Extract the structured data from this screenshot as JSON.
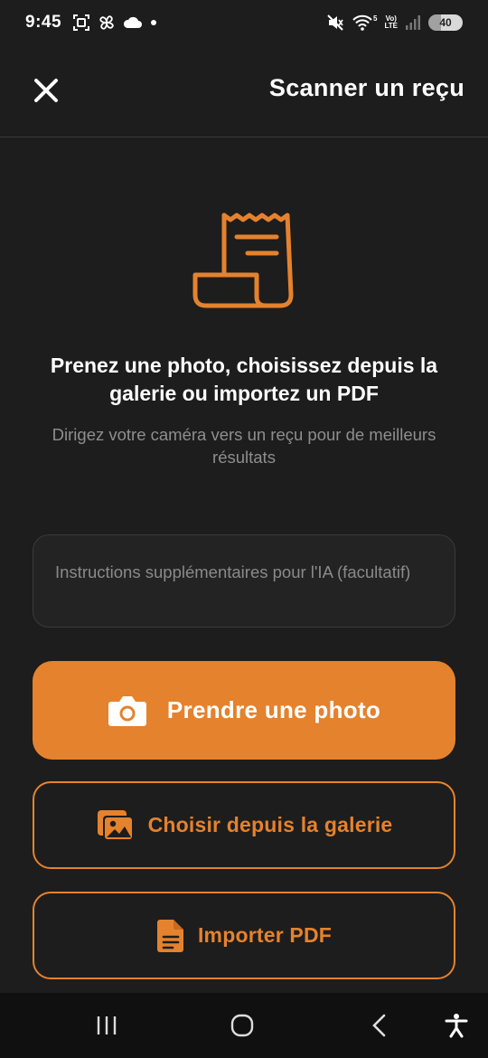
{
  "status_bar": {
    "time": "9:45",
    "network_label_top": "Vo)",
    "network_label_bottom": "LTE",
    "network_5": "5",
    "battery": "40"
  },
  "header": {
    "title": "Scanner un reçu",
    "close_icon": "close-icon"
  },
  "hero": {
    "icon": "receipt-icon",
    "title": "Prenez une photo, choisissez depuis la galerie ou importez un PDF",
    "subtitle": "Dirigez votre caméra vers un reçu pour de meilleurs résultats"
  },
  "instructions": {
    "placeholder": "Instructions supplémentaires pour l'IA (facultatif)",
    "value": ""
  },
  "actions": {
    "take_photo": {
      "label": "Prendre une photo",
      "icon": "camera-icon"
    },
    "gallery": {
      "label": "Choisir depuis la galerie",
      "icon": "gallery-icon"
    },
    "pdf": {
      "label": "Importer PDF",
      "icon": "file-icon"
    }
  },
  "nav_bar": {
    "items": [
      "recent-apps-icon",
      "home-icon",
      "back-icon",
      "accessibility-icon"
    ]
  },
  "colors": {
    "accent": "#e5822d",
    "background": "#1d1d1d",
    "muted_text": "#8e8e8e"
  }
}
